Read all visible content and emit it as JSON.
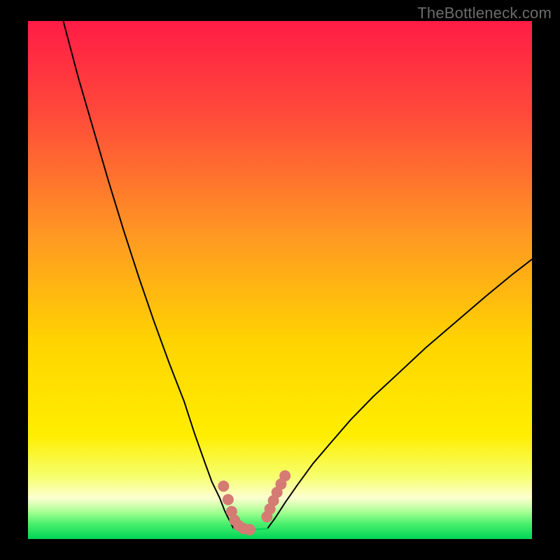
{
  "watermark": "TheBottleneck.com",
  "chart_data": {
    "type": "line",
    "title": "",
    "xlabel": "",
    "ylabel": "",
    "xlim": [
      0,
      100
    ],
    "ylim": [
      0,
      100
    ],
    "grid": false,
    "legend": false,
    "background_gradient": {
      "top_color": "#ff1f46",
      "mid_color": "#ffe400",
      "green_band_top": "#f7ff8c",
      "green_band_bottom": "#00e05a"
    },
    "series": [
      {
        "name": "left-curve",
        "stroke": "#000000",
        "x": [
          7,
          10,
          13,
          16,
          19,
          22,
          25,
          28,
          31,
          33,
          35,
          36.5,
          38,
          39,
          40,
          40.8
        ],
        "values": [
          100,
          89,
          79,
          69,
          59.5,
          50.5,
          42,
          34,
          26.5,
          20.5,
          15,
          11,
          8,
          5.5,
          3.5,
          2
        ]
      },
      {
        "name": "right-curve",
        "stroke": "#000000",
        "x": [
          47.5,
          49,
          51,
          53.5,
          56.5,
          60,
          64,
          68.5,
          73.5,
          79,
          85,
          91,
          96,
          100
        ],
        "values": [
          2,
          4,
          7,
          10.5,
          14.5,
          18.5,
          23,
          27.5,
          32,
          37,
          42,
          47,
          51,
          54
        ]
      },
      {
        "name": "valley-flat",
        "stroke": "#00d556",
        "x": [
          40.8,
          42.5,
          44.5,
          47.5
        ],
        "values": [
          2,
          1.8,
          1.8,
          2
        ]
      }
    ],
    "markers": [
      {
        "name": "left-dots",
        "color": "#d47b73",
        "radius": 8,
        "x": [
          38.8,
          39.7,
          40.4,
          41.0,
          41.8,
          42.8,
          44.0
        ],
        "values": [
          10.2,
          7.6,
          5.3,
          3.6,
          2.6,
          2.0,
          1.8
        ]
      },
      {
        "name": "right-dots",
        "color": "#d47b73",
        "radius": 8,
        "x": [
          47.4,
          48.0,
          48.7,
          49.4,
          50.2,
          51.0
        ],
        "values": [
          4.3,
          5.8,
          7.4,
          9.0,
          10.6,
          12.2
        ]
      }
    ]
  }
}
